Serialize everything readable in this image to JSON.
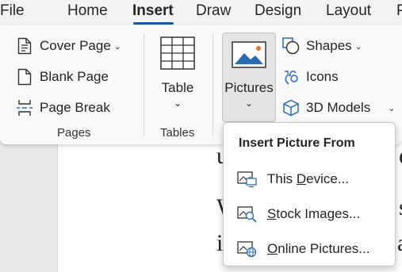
{
  "menubar": {
    "tabs": [
      {
        "label": "File"
      },
      {
        "label": "Home"
      },
      {
        "label": "Insert"
      },
      {
        "label": "Draw"
      },
      {
        "label": "Design"
      },
      {
        "label": "Layout"
      },
      {
        "label": "P"
      }
    ],
    "active_tab": "Insert",
    "accent_color": "#1e56a0"
  },
  "ribbon": {
    "pages_group": {
      "label": "Pages",
      "cover_page": "Cover Page",
      "blank_page": "Blank Page",
      "page_break": "Page Break"
    },
    "tables_group": {
      "label": "Tables",
      "table": "Table"
    },
    "illustrations_group": {
      "pictures": "Pictures",
      "shapes": "Shapes",
      "icons": "Icons",
      "models_3d": "3D Models"
    }
  },
  "dropdown": {
    "title": "Insert Picture From",
    "items": [
      {
        "label": "This Device...",
        "access_key": "D",
        "icon": "device-picture-icon"
      },
      {
        "label": "Stock Images...",
        "access_key": "S",
        "icon": "stock-images-icon"
      },
      {
        "label": "Online Pictures...",
        "access_key": "O",
        "icon": "online-pictures-icon"
      }
    ]
  },
  "document": {
    "visible_fragments": [
      "u",
      "e",
      "W",
      "s",
      "i",
      "a"
    ]
  }
}
